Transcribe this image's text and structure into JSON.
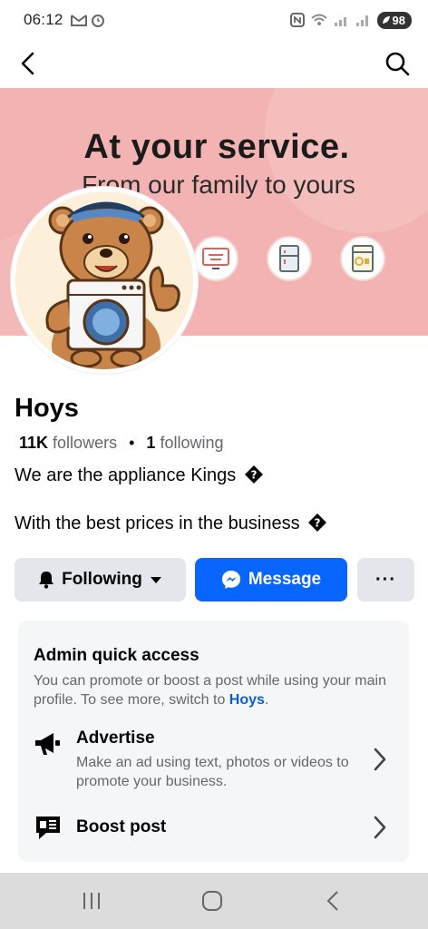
{
  "status": {
    "time": "06:12",
    "battery": "98"
  },
  "cover": {
    "headline": "At your service.",
    "subline": "From our family to yours"
  },
  "profile": {
    "name": "Hoys",
    "followers_count": "11K",
    "followers_label": "followers",
    "separator": "•",
    "following_count": "1",
    "following_label": "following",
    "bio_line1": "We are the appliance Kings",
    "bio_line2": "With the best prices in the business"
  },
  "actions": {
    "following": "Following",
    "message": "Message",
    "more": "···"
  },
  "admin": {
    "title": "Admin quick access",
    "desc_prefix": "You can promote or boost a post while using your main profile. To see more, switch to ",
    "desc_link": "Hoys",
    "desc_suffix": ".",
    "items": [
      {
        "title": "Advertise",
        "desc": "Make an ad using text, photos or videos to promote your business.",
        "icon": "megaphone-icon"
      },
      {
        "title": "Boost post",
        "desc": "",
        "icon": "boost-post-icon"
      }
    ]
  },
  "colors": {
    "brand_blue": "#0866ff",
    "cover_pink": "#f2b3b2",
    "button_gray": "#e4e6eb"
  }
}
